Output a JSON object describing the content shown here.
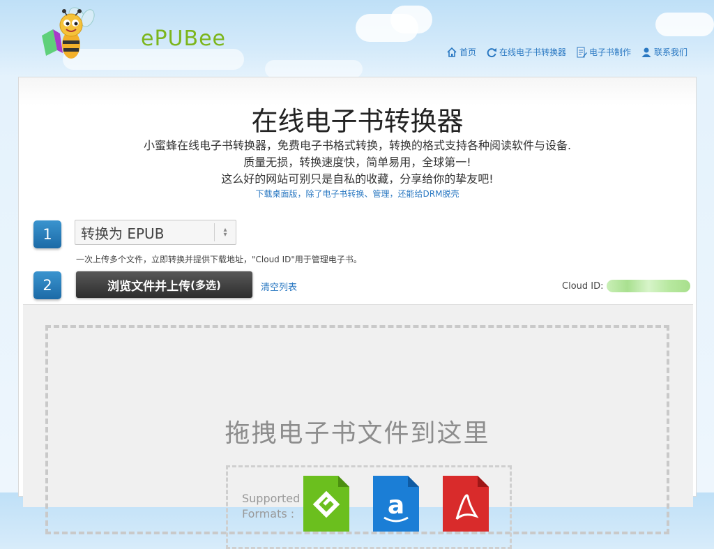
{
  "brand": {
    "name": "ePUBee"
  },
  "nav": [
    {
      "label": "首页",
      "icon": "home-icon"
    },
    {
      "label": "在线电子书转换器",
      "icon": "refresh-icon"
    },
    {
      "label": "电子书制作",
      "icon": "document-edit-icon"
    },
    {
      "label": "联系我们",
      "icon": "user-icon"
    }
  ],
  "header": {
    "title": "在线电子书转换器",
    "desc1": "小蜜蜂在线电子书转换器，免费电子书格式转换，转换的格式支持各种阅读软件与设备.",
    "desc2": "质量无损，转换速度快，简单易用，全球第一!",
    "desc3": "这么好的网站可别只是自私的收藏，分享给你的挚友吧!",
    "download_link": "下载桌面版，除了电子书转换、管理，还能给DRM脱壳"
  },
  "step1": {
    "number": "1",
    "select_value": "转换为 EPUB",
    "hint": "一次上传多个文件，立即转换并提供下载地址，\"Cloud ID\"用于管理电子书。"
  },
  "step2": {
    "number": "2",
    "upload_label": "浏览文件并上传",
    "upload_suffix": "(多选)",
    "clear_label": "清空列表",
    "cloud_id_label": "Cloud ID:"
  },
  "dropzone": {
    "text": "拖拽电子书文件到这里",
    "supported_label_1": "Supported",
    "supported_label_2": "Formats :",
    "formats": [
      "epub-icon",
      "amazon-kindle-icon",
      "pdf-icon"
    ]
  },
  "colors": {
    "link": "#2a78c2",
    "step_badge": "#1c6aa6",
    "epub_green": "#6bbf1e",
    "amazon_blue": "#1b7ed6",
    "pdf_red": "#d92b2b"
  }
}
